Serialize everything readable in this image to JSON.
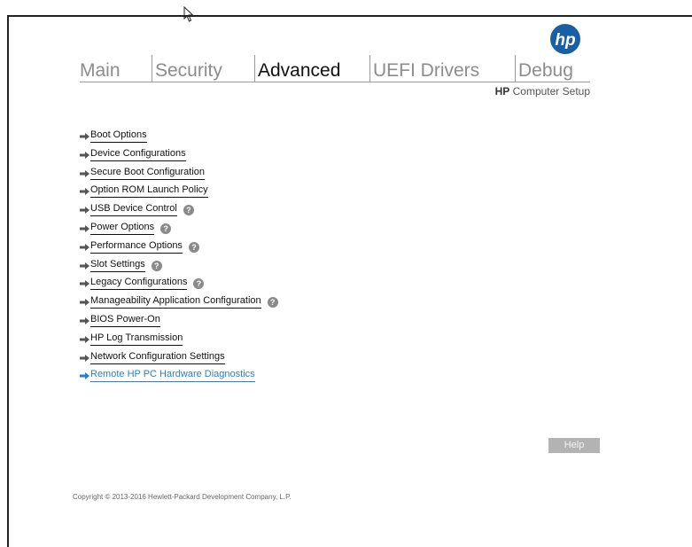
{
  "app": {
    "logo_text": "hp",
    "subtitle_brand": "HP",
    "subtitle_rest": " Computer Setup"
  },
  "tabs": [
    {
      "label": "Main",
      "active": false
    },
    {
      "label": "Security",
      "active": false
    },
    {
      "label": "Advanced",
      "active": true
    },
    {
      "label": "UEFI Drivers",
      "active": false
    },
    {
      "label": "Debug",
      "active": false
    }
  ],
  "menu": {
    "items": [
      {
        "label": "Boot Options",
        "has_help": false
      },
      {
        "label": "Device Configurations",
        "has_help": false
      },
      {
        "label": "Secure Boot Configuration",
        "has_help": false
      },
      {
        "label": "Option ROM Launch Policy",
        "has_help": false
      },
      {
        "label": "USB Device Control",
        "has_help": true
      },
      {
        "label": "Power Options",
        "has_help": true
      },
      {
        "label": "Performance Options",
        "has_help": true
      },
      {
        "label": "Slot Settings",
        "has_help": true
      },
      {
        "label": "Legacy Configurations",
        "has_help": true
      },
      {
        "label": "Manageability Application Configuration",
        "has_help": true
      },
      {
        "label": "BIOS Power-On",
        "has_help": false
      },
      {
        "label": "HP Log Transmission",
        "has_help": false
      },
      {
        "label": "Network Configuration Settings",
        "has_help": false
      },
      {
        "label": "Remote HP PC Hardware Diagnostics",
        "has_help": false,
        "link": true
      }
    ],
    "help_glyph": "?"
  },
  "help_button": {
    "label": "Help"
  },
  "footer": {
    "copyright": "Copyright © 2013-2016 Hewlett-Packard Development Company, L.P."
  },
  "icons": {
    "arrow": "arrow-right-icon",
    "help": "question-circle-icon",
    "cursor": "mouse-pointer-icon",
    "logo": "hp-logo-icon"
  },
  "colors": {
    "brand_blue": "#1a5fa6",
    "link_blue": "#2b7fc4",
    "active_tab": "#111111",
    "inactive_tab": "#8c8c8c",
    "help_button_bg": "#b3b3b3"
  }
}
